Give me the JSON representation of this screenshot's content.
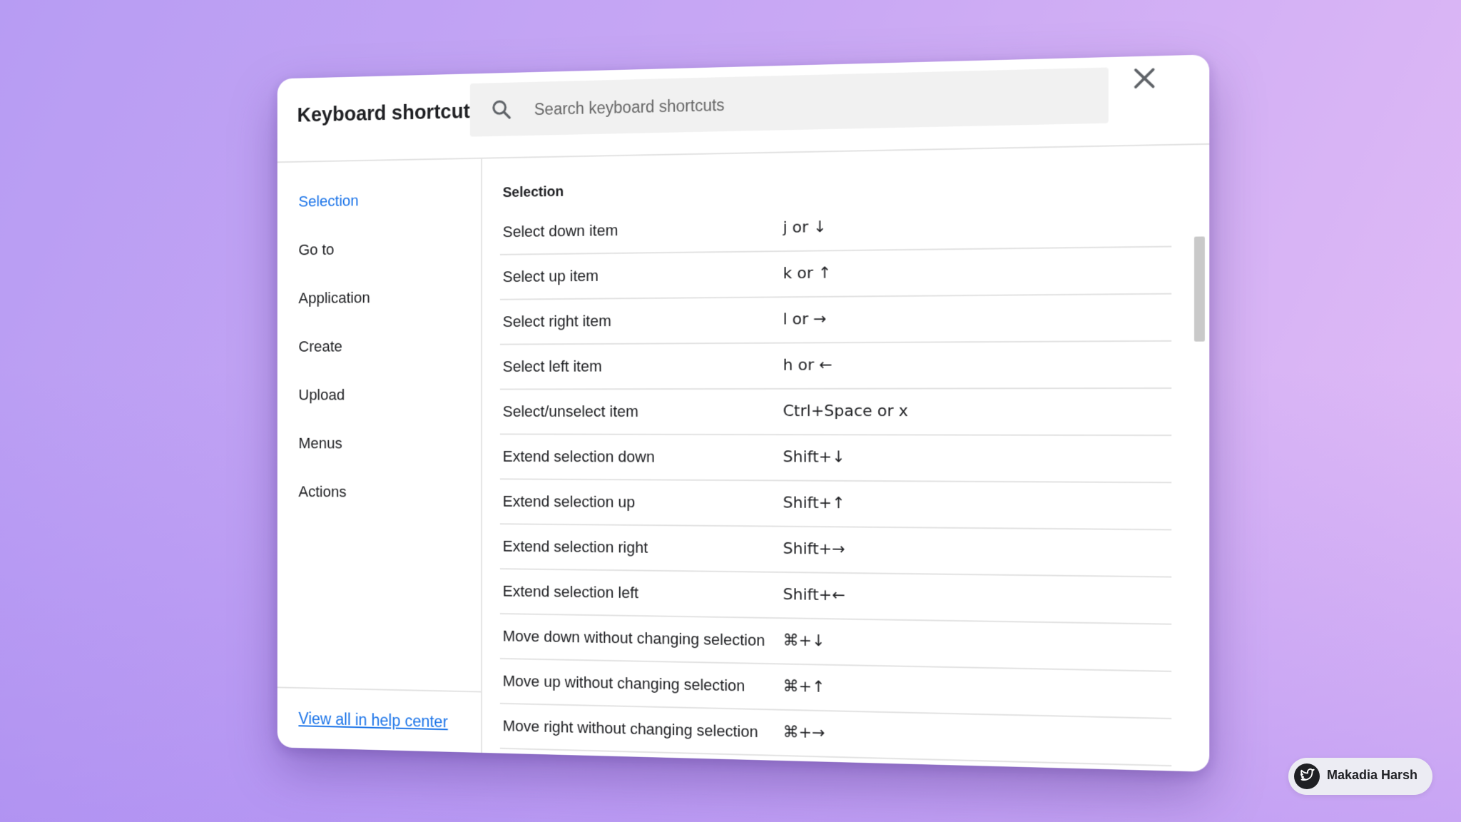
{
  "dialog": {
    "title": "Keyboard shortcuts",
    "search": {
      "placeholder": "Search keyboard shortcuts",
      "value": ""
    },
    "close_icon": "close-icon"
  },
  "sidebar": {
    "items": [
      {
        "label": "Selection",
        "active": true
      },
      {
        "label": "Go to",
        "active": false
      },
      {
        "label": "Application",
        "active": false
      },
      {
        "label": "Create",
        "active": false
      },
      {
        "label": "Upload",
        "active": false
      },
      {
        "label": "Menus",
        "active": false
      },
      {
        "label": "Actions",
        "active": false
      }
    ],
    "footer_link": "View all in help center"
  },
  "content": {
    "section_title": "Selection",
    "shortcuts": [
      {
        "action": "Select down item",
        "keys": "j or ↓"
      },
      {
        "action": "Select up item",
        "keys": "k or ↑"
      },
      {
        "action": "Select right item",
        "keys": "l or →"
      },
      {
        "action": "Select left item",
        "keys": "h or ←"
      },
      {
        "action": "Select/unselect item",
        "keys": "Ctrl+Space or x"
      },
      {
        "action": "Extend selection down",
        "keys": "Shift+↓"
      },
      {
        "action": "Extend selection up",
        "keys": "Shift+↑"
      },
      {
        "action": "Extend selection right",
        "keys": "Shift+→"
      },
      {
        "action": "Extend selection left",
        "keys": "Shift+←"
      },
      {
        "action": "Move down without changing selection",
        "keys": "⌘+↓"
      },
      {
        "action": "Move up without changing selection",
        "keys": "⌘+↑"
      },
      {
        "action": "Move right without changing selection",
        "keys": "⌘+→"
      }
    ]
  },
  "badge": {
    "name": "Makadia Harsh",
    "icon": "bird-logo-icon"
  },
  "colors": {
    "accent": "#1a73e8",
    "background_start": "#b79cf3",
    "background_end": "#e3bdf6"
  }
}
